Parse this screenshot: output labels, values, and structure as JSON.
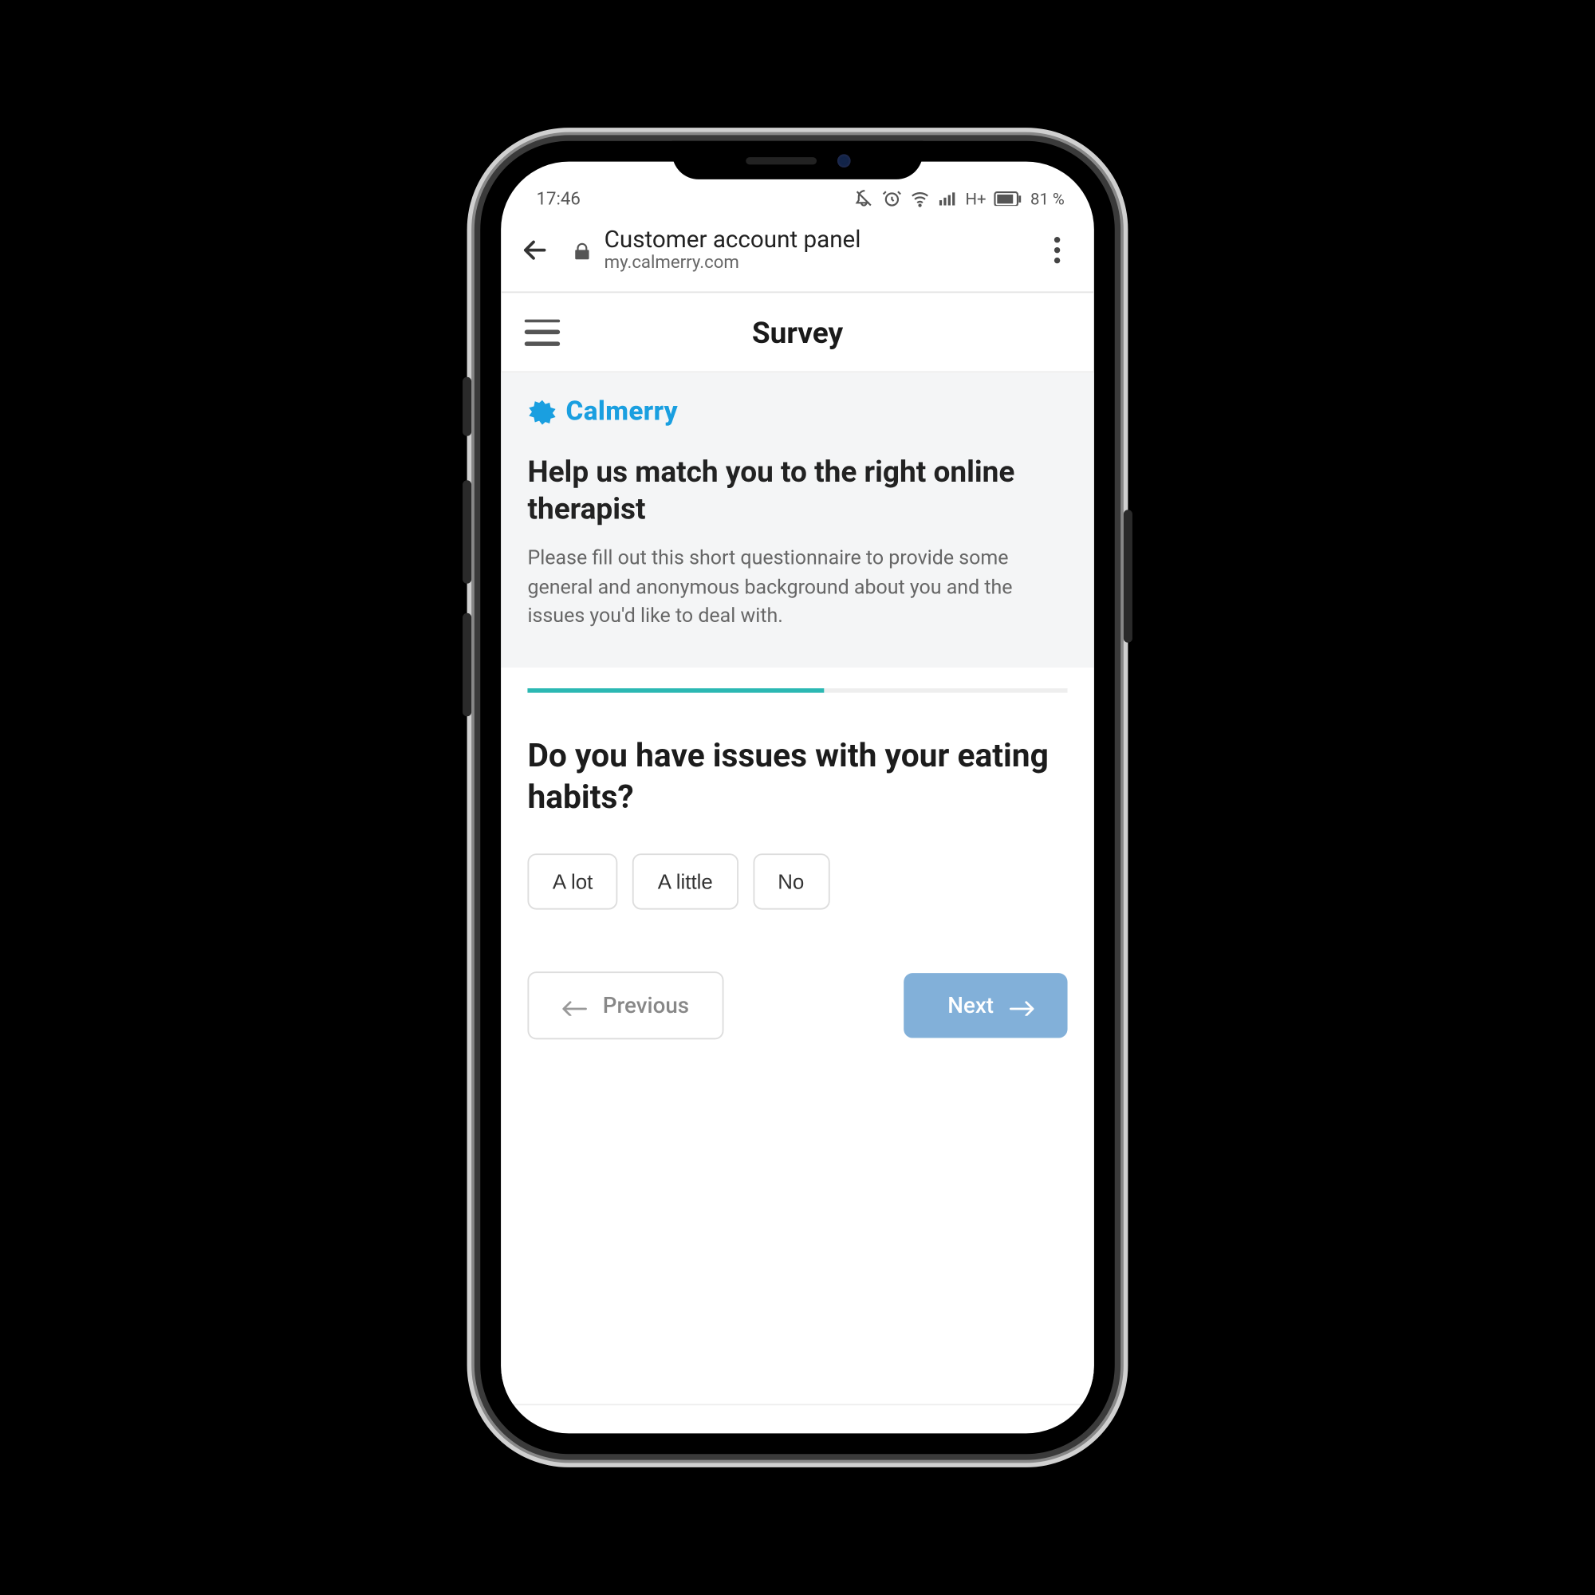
{
  "status": {
    "time": "17:46",
    "network": "H+",
    "battery": "81 %"
  },
  "browser": {
    "title": "Customer account panel",
    "url": "my.calmerry.com"
  },
  "app": {
    "title": "Survey",
    "brand": "Calmerry"
  },
  "intro": {
    "heading": "Help us match you to the right online therapist",
    "body": "Please fill out this short questionnaire to provide some general and anonymous background about you and the issues you'd like to deal with."
  },
  "survey": {
    "progress_pct": 55,
    "question": "Do you have issues with your eating habits?",
    "options": [
      "A lot",
      "A little",
      "No"
    ],
    "prev_label": "Previous",
    "next_label": "Next"
  }
}
